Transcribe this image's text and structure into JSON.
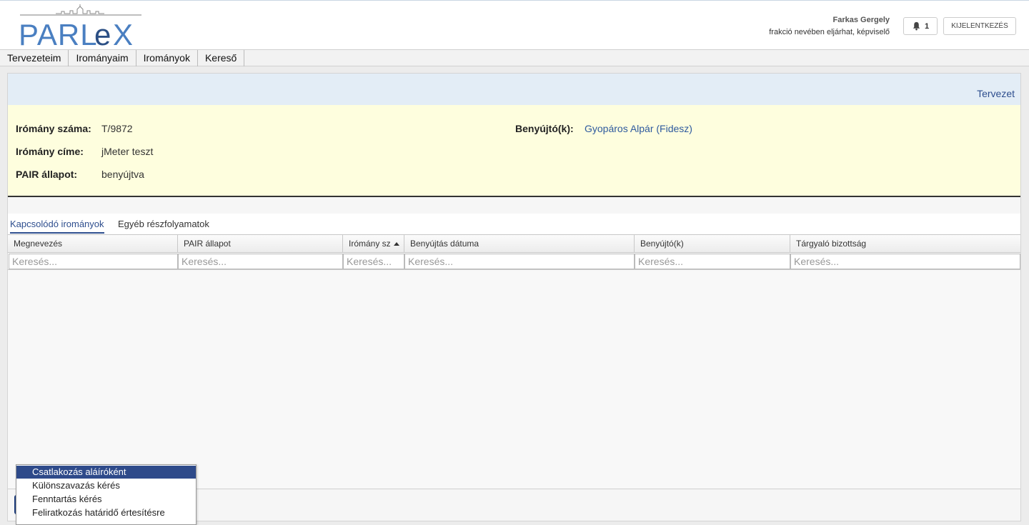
{
  "header": {
    "logo_text": "PARLEX",
    "user_name": "Farkas Gergely",
    "user_role": "frakció nevében eljárhat, képviselő",
    "notification_count": "1",
    "logout_label": "KIJELENTKEZÉS"
  },
  "menu": {
    "items": [
      {
        "label": "Tervezeteim"
      },
      {
        "label": "Irományaim"
      },
      {
        "label": "Irományok"
      },
      {
        "label": "Kereső"
      }
    ]
  },
  "panel": {
    "header_link": "Tervezet",
    "info": {
      "number_label": "Irómány száma:",
      "number_value": "T/9872",
      "title_label": "Irómány címe:",
      "title_value": "jMeter teszt",
      "status_label": "PAIR állapot:",
      "status_value": "benyújtva",
      "submitter_label": "Benyújtó(k):",
      "submitter_value": "Gyopáros Alpár (Fidesz)"
    },
    "tabs": [
      {
        "label": "Kapcsolódó irományok",
        "active": true
      },
      {
        "label": "Egyéb részfolyamatok",
        "active": false
      }
    ],
    "grid": {
      "columns": [
        {
          "label": "Megnevezés"
        },
        {
          "label": "PAIR állapot"
        },
        {
          "label": "Irómány sz"
        },
        {
          "label": "Benyújtás dátuma"
        },
        {
          "label": "Benyújtó(k)"
        },
        {
          "label": "Tárgyaló bizottság"
        }
      ],
      "filter_placeholder": "Keresés..."
    }
  },
  "dropdown": {
    "items": [
      {
        "label": "Csatlakozás aláíróként",
        "selected": true
      },
      {
        "label": "Különszavazás kérés",
        "selected": false
      },
      {
        "label": "Fenntartás kérés",
        "selected": false
      },
      {
        "label": "Feliratkozás határidő értesítésre",
        "selected": false
      }
    ]
  },
  "colors": {
    "brand_blue": "#4a7fc1",
    "selected_item": "#2e4a8a",
    "info_background": "#fefede",
    "header_background": "#e3edf6"
  }
}
